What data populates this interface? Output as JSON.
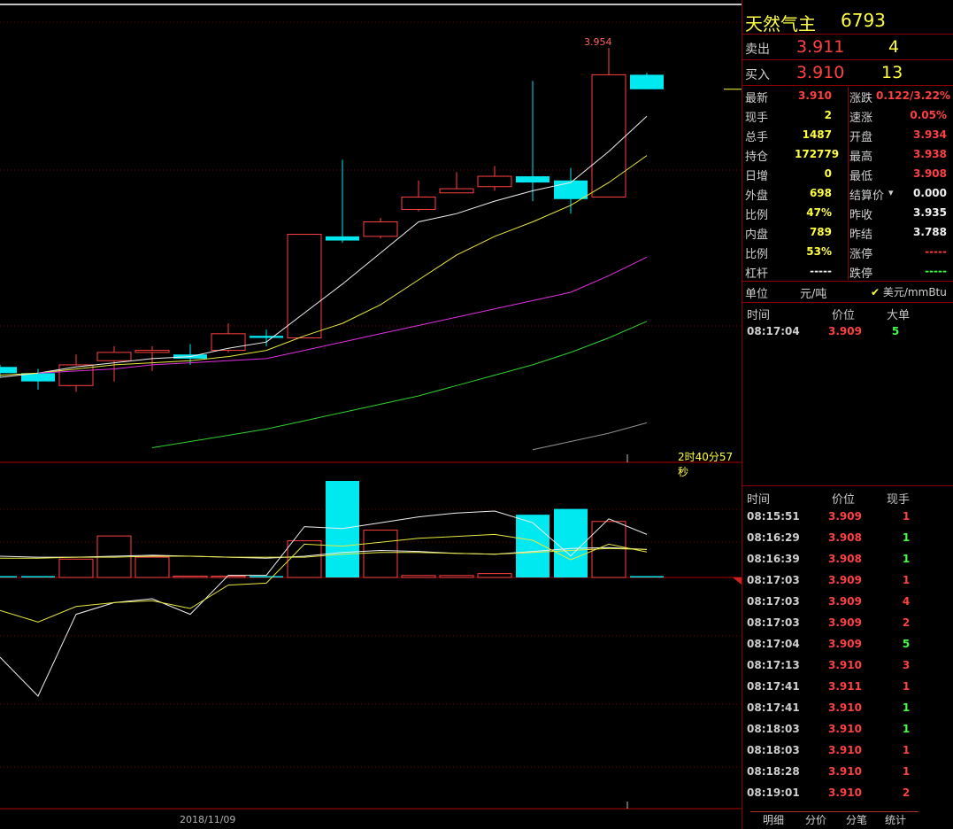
{
  "instrument": {
    "name": "天然气主",
    "code": "6793"
  },
  "quote": {
    "sell_label": "卖出",
    "sell_price": "3.911",
    "sell_vol": "4",
    "buy_label": "买入",
    "buy_price": "3.910",
    "buy_vol": "13"
  },
  "stats": [
    {
      "l1": "最新",
      "v1": "3.910",
      "c1": "red",
      "l2": "涨跌",
      "v2": "0.122/3.22%",
      "c2": "red"
    },
    {
      "l1": "现手",
      "v1": "2",
      "c1": "yellow",
      "l2": "速涨",
      "v2": "0.05%",
      "c2": "red"
    },
    {
      "l1": "总手",
      "v1": "1487",
      "c1": "yellow",
      "l2": "开盘",
      "v2": "3.934",
      "c2": "red"
    },
    {
      "l1": "持仓",
      "v1": "172779",
      "c1": "yellow",
      "l2": "最高",
      "v2": "3.938",
      "c2": "red"
    },
    {
      "l1": "日增",
      "v1": "0",
      "c1": "yellow",
      "l2": "最低",
      "v2": "3.908",
      "c2": "red"
    },
    {
      "l1": "外盘",
      "v1": "698",
      "c1": "yellow",
      "l2": "结算价",
      "v2": "0.000",
      "c2": "white"
    },
    {
      "l1": "比例",
      "v1": "47%",
      "c1": "yellow",
      "l2": "昨收",
      "v2": "3.935",
      "c2": "white"
    },
    {
      "l1": "内盘",
      "v1": "789",
      "c1": "yellow",
      "l2": "昨结",
      "v2": "3.788",
      "c2": "white"
    },
    {
      "l1": "比例",
      "v1": "53%",
      "c1": "yellow",
      "l2": "涨停",
      "v2": "-----",
      "c2": "red"
    },
    {
      "l1": "杠杆",
      "v1": "-----",
      "c1": "white",
      "l2": "跌停",
      "v2": "-----",
      "c2": "green"
    }
  ],
  "unit": {
    "label": "单位",
    "value": "元/吨",
    "alt": "美元/mmBtu"
  },
  "big_orders": {
    "headers": [
      "时间",
      "价位",
      "大单"
    ],
    "rows": [
      {
        "time": "08:17:04",
        "price": "3.909",
        "vol": "5",
        "color": "green"
      }
    ]
  },
  "ticks": {
    "headers": [
      "时间",
      "价位",
      "现手"
    ],
    "rows": [
      {
        "time": "08:15:51",
        "price": "3.909",
        "vol": "1",
        "color": "red"
      },
      {
        "time": "08:16:29",
        "price": "3.908",
        "vol": "1",
        "color": "green"
      },
      {
        "time": "08:16:39",
        "price": "3.908",
        "vol": "1",
        "color": "green"
      },
      {
        "time": "08:17:03",
        "price": "3.909",
        "vol": "1",
        "color": "red"
      },
      {
        "time": "08:17:03",
        "price": "3.909",
        "vol": "4",
        "color": "red"
      },
      {
        "time": "08:17:03",
        "price": "3.909",
        "vol": "2",
        "color": "red"
      },
      {
        "time": "08:17:04",
        "price": "3.909",
        "vol": "5",
        "color": "green"
      },
      {
        "time": "08:17:13",
        "price": "3.910",
        "vol": "3",
        "color": "red"
      },
      {
        "time": "08:17:41",
        "price": "3.911",
        "vol": "1",
        "color": "red"
      },
      {
        "time": "08:17:41",
        "price": "3.910",
        "vol": "1",
        "color": "green"
      },
      {
        "time": "08:18:03",
        "price": "3.910",
        "vol": "1",
        "color": "green"
      },
      {
        "time": "08:18:03",
        "price": "3.910",
        "vol": "1",
        "color": "red"
      },
      {
        "time": "08:18:28",
        "price": "3.910",
        "vol": "1",
        "color": "red"
      },
      {
        "time": "08:19:01",
        "price": "3.910",
        "vol": "2",
        "color": "red"
      }
    ]
  },
  "tabs": [
    "明细",
    "分价",
    "分笔",
    "统计"
  ],
  "chart_labels": {
    "high_label": "3.954",
    "countdown": "2时40分57秒",
    "date": "2018/11/09"
  },
  "chart_data": {
    "type": "candlestick",
    "candles": [
      {
        "o": 3.8,
        "c": 3.797,
        "h": 3.801,
        "l": 3.795
      },
      {
        "o": 3.797,
        "c": 3.793,
        "h": 3.799,
        "l": 3.789
      },
      {
        "o": 3.791,
        "c": 3.801,
        "h": 3.806,
        "l": 3.788
      },
      {
        "o": 3.803,
        "c": 3.807,
        "h": 3.81,
        "l": 3.793
      },
      {
        "o": 3.807,
        "c": 3.808,
        "h": 3.81,
        "l": 3.798
      },
      {
        "o": 3.806,
        "c": 3.804,
        "h": 3.811,
        "l": 3.801
      },
      {
        "o": 3.808,
        "c": 3.816,
        "h": 3.821,
        "l": 3.807
      },
      {
        "o": 3.815,
        "c": 3.814,
        "h": 3.818,
        "l": 3.81
      },
      {
        "o": 3.814,
        "c": 3.864,
        "h": 3.864,
        "l": 3.814
      },
      {
        "o": 3.863,
        "c": 3.861,
        "h": 3.9,
        "l": 3.86
      },
      {
        "o": 3.863,
        "c": 3.87,
        "h": 3.872,
        "l": 3.862
      },
      {
        "o": 3.876,
        "c": 3.882,
        "h": 3.89,
        "l": 3.875
      },
      {
        "o": 3.884,
        "c": 3.886,
        "h": 3.894,
        "l": 3.884
      },
      {
        "o": 3.887,
        "c": 3.892,
        "h": 3.897,
        "l": 3.885
      },
      {
        "o": 3.892,
        "c": 3.889,
        "h": 3.938,
        "l": 3.88
      },
      {
        "o": 3.89,
        "c": 3.881,
        "h": 3.896,
        "l": 3.874
      },
      {
        "o": 3.882,
        "c": 3.941,
        "h": 3.954,
        "l": 3.882
      },
      {
        "o": 3.941,
        "c": 3.934,
        "h": 3.942,
        "l": 3.934
      }
    ],
    "ma_white": [
      3.795,
      3.797,
      3.8,
      3.802,
      3.804,
      3.805,
      3.809,
      3.812,
      3.826,
      3.84,
      3.855,
      3.87,
      3.874,
      3.88,
      3.885,
      3.889,
      3.904,
      3.921
    ],
    "ma_yellow": [
      3.796,
      3.797,
      3.799,
      3.801,
      3.802,
      3.803,
      3.805,
      3.808,
      3.815,
      3.821,
      3.83,
      3.842,
      3.854,
      3.863,
      3.87,
      3.878,
      3.889,
      3.902
    ],
    "ma_magenta": [
      null,
      3.797,
      3.798,
      3.799,
      3.801,
      3.802,
      3.803,
      3.804,
      3.808,
      3.812,
      3.816,
      3.82,
      3.824,
      3.828,
      3.832,
      3.836,
      3.844,
      3.853
    ],
    "ma_green": [
      null,
      null,
      null,
      null,
      3.761,
      3.764,
      3.767,
      3.77,
      3.774,
      3.778,
      3.782,
      3.786,
      3.791,
      3.796,
      3.801,
      3.807,
      3.814,
      3.822
    ],
    "ma_gray": [
      null,
      null,
      null,
      null,
      null,
      null,
      null,
      null,
      null,
      null,
      null,
      null,
      null,
      null,
      3.76,
      3.764,
      3.768,
      3.773
    ],
    "last_price": 3.934,
    "volume": [
      1,
      0.5,
      19,
      43,
      21,
      0,
      1,
      1,
      38,
      100,
      49,
      2,
      2,
      4,
      65,
      71,
      58,
      1
    ],
    "vol_colors": [
      "cyan",
      "cyan",
      "red",
      "red",
      "red",
      "red",
      "red",
      "cyan",
      "red",
      "cyan",
      "red",
      "red",
      "red",
      "red",
      "cyan",
      "cyan",
      "red",
      "cyan"
    ],
    "vol_ma": [
      22,
      21,
      21,
      22,
      23,
      22,
      21,
      20,
      22,
      26,
      28,
      27,
      25,
      24,
      27,
      30,
      31,
      29
    ],
    "vol_ma2": [
      20,
      20,
      21,
      21,
      22,
      22,
      21,
      21,
      21,
      24,
      26,
      26,
      25,
      24,
      26,
      28,
      30,
      29
    ],
    "osc_white": [
      40,
      20,
      62,
      68,
      70,
      62,
      82,
      82,
      107,
      106,
      109,
      112,
      114,
      115,
      109,
      92,
      111,
      103
    ],
    "osc_yellow": [
      64,
      58,
      66,
      68,
      69,
      65,
      77,
      78,
      98,
      97,
      99,
      101,
      102,
      103,
      100,
      90,
      98,
      94
    ]
  }
}
